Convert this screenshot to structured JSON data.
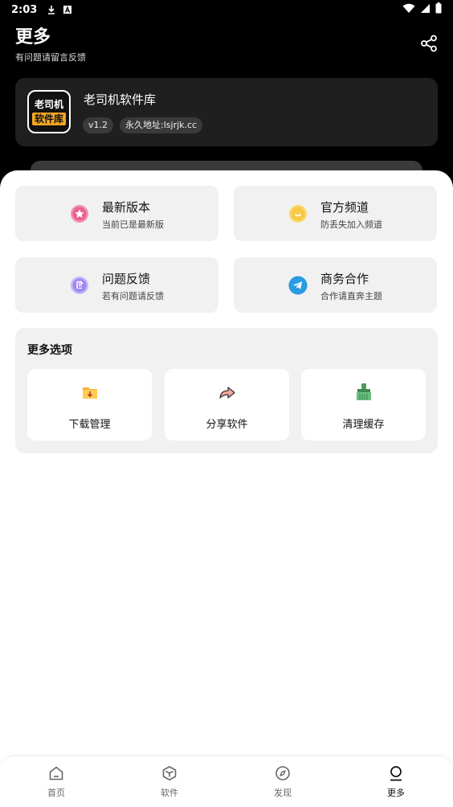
{
  "status_bar": {
    "time": "2:03",
    "icons": [
      "download-icon",
      "a-icon",
      "wifi-icon",
      "signal-icon",
      "battery-icon"
    ]
  },
  "header": {
    "title": "更多",
    "subtitle": "有问题请留言反馈"
  },
  "app_card": {
    "logo_line1": "老司机",
    "logo_line2": "软件库",
    "name": "老司机软件库",
    "version": "v1.2",
    "address": "永久地址:lsjrjk.cc"
  },
  "tiles": [
    {
      "title": "最新版本",
      "subtitle": "当前已是最新版",
      "icon": "star-icon",
      "color": "#f06292"
    },
    {
      "title": "官方频道",
      "subtitle": "防丢失加入频道",
      "icon": "smile-icon",
      "color": "#f7c948"
    },
    {
      "title": "问题反馈",
      "subtitle": "若有问题请反馈",
      "icon": "feedback-icon",
      "color": "#9f86f0"
    },
    {
      "title": "商务合作",
      "subtitle": "合作请直奔主题",
      "icon": "telegram-icon",
      "color": "#2a9be0"
    }
  ],
  "more_options": {
    "title": "更多选项",
    "items": [
      {
        "label": "下载管理",
        "icon": "download-folder-icon"
      },
      {
        "label": "分享软件",
        "icon": "share-arrow-icon"
      },
      {
        "label": "清理缓存",
        "icon": "broom-icon"
      }
    ]
  },
  "bottom_nav": [
    {
      "label": "首页",
      "icon": "home-icon"
    },
    {
      "label": "软件",
      "icon": "package-icon"
    },
    {
      "label": "发现",
      "icon": "compass-icon"
    },
    {
      "label": "更多",
      "icon": "user-icon",
      "active": true
    }
  ]
}
